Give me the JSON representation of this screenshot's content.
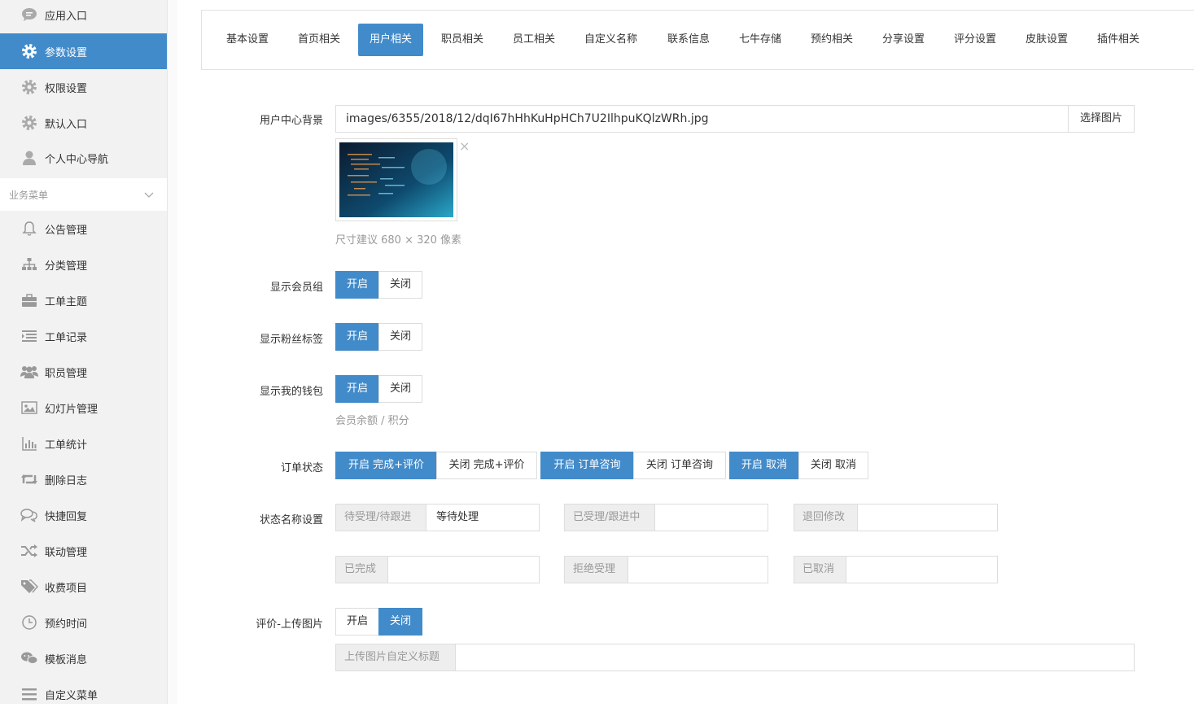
{
  "sidebar": {
    "top_items": [
      {
        "label": "应用入口",
        "icon": "chat-icon",
        "active": false
      },
      {
        "label": "参数设置",
        "icon": "gear-icon",
        "active": true
      },
      {
        "label": "权限设置",
        "icon": "gear-icon",
        "active": false
      },
      {
        "label": "默认入口",
        "icon": "gear-icon",
        "active": false
      },
      {
        "label": "个人中心导航",
        "icon": "user-icon",
        "active": false
      }
    ],
    "group_label": "业务菜单",
    "group_items": [
      {
        "label": "公告管理",
        "icon": "bell-icon"
      },
      {
        "label": "分类管理",
        "icon": "sitemap-icon"
      },
      {
        "label": "工单主题",
        "icon": "briefcase-icon"
      },
      {
        "label": "工单记录",
        "icon": "list-icon"
      },
      {
        "label": "职员管理",
        "icon": "users-icon"
      },
      {
        "label": "幻灯片管理",
        "icon": "image-icon"
      },
      {
        "label": "工单统计",
        "icon": "bar-chart-icon"
      },
      {
        "label": "删除日志",
        "icon": "retweet-icon"
      },
      {
        "label": "快捷回复",
        "icon": "comments-icon"
      },
      {
        "label": "联动管理",
        "icon": "random-icon"
      },
      {
        "label": "收费项目",
        "icon": "tags-icon"
      },
      {
        "label": "预约时间",
        "icon": "clock-icon"
      },
      {
        "label": "模板消息",
        "icon": "wechat-icon"
      },
      {
        "label": "自定义菜单",
        "icon": "menu-icon"
      }
    ]
  },
  "tabs": [
    "基本设置",
    "首页相关",
    "用户相关",
    "职员相关",
    "员工相关",
    "自定义名称",
    "联系信息",
    "七牛存储",
    "预约相关",
    "分享设置",
    "评分设置",
    "皮肤设置",
    "插件相关"
  ],
  "active_tab": "用户相关",
  "form": {
    "bg_label": "用户中心背景",
    "bg_value": "images/6355/2018/12/dqI67hHhKuHpHCh7U2IlhpuKQlzWRh.jpg",
    "bg_button": "选择图片",
    "bg_hint": "尺寸建议 680 × 320 像素",
    "remove_glyph": "×",
    "show_group_label": "显示会员组",
    "show_fans_label": "显示粉丝标签",
    "show_wallet_label": "显示我的钱包",
    "wallet_hint": "会员余额 / 积分",
    "on": "开启",
    "off": "关闭",
    "order_status_label": "订单状态",
    "order_status_buttons": [
      {
        "label": "开启 完成+评价",
        "on": true
      },
      {
        "label": "关闭 完成+评价",
        "on": false
      },
      {
        "label": "开启 订单咨询",
        "on": true
      },
      {
        "label": "关闭 订单咨询",
        "on": false
      },
      {
        "label": "开启 取消",
        "on": true
      },
      {
        "label": "关闭 取消",
        "on": false
      }
    ],
    "status_name_label": "状态名称设置",
    "status_fields": [
      {
        "addon": "待受理/待跟进",
        "value": "等待处理"
      },
      {
        "addon": "已受理/跟进中",
        "value": ""
      },
      {
        "addon": "退回修改",
        "value": ""
      },
      {
        "addon": "已完成",
        "value": ""
      },
      {
        "addon": "拒绝受理",
        "value": ""
      },
      {
        "addon": "已取消",
        "value": ""
      }
    ],
    "review_upload_label": "评价-上传图片",
    "upload_title_addon": "上传图片自定义标题",
    "upload_title_value": ""
  },
  "colors": {
    "accent": "#428bca",
    "sidebar_bg": "#f2f2f2"
  }
}
